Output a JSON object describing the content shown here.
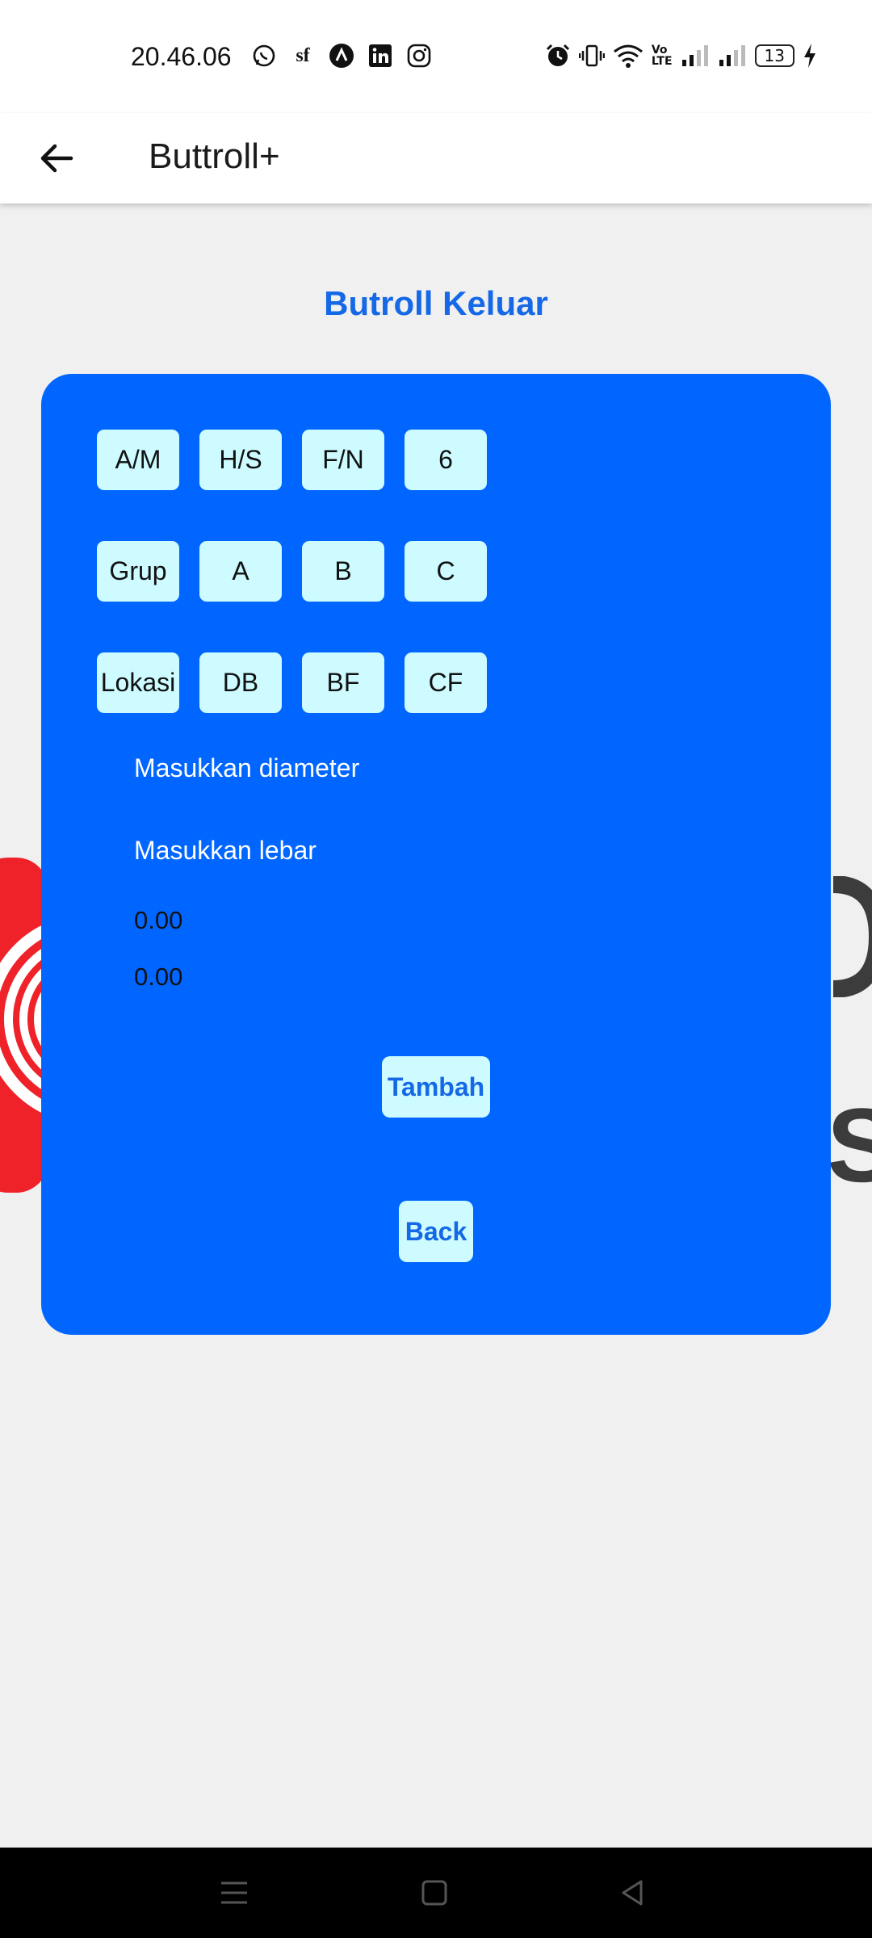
{
  "status_bar": {
    "time": "20.46.06",
    "left_icons": [
      "whatsapp-icon",
      "sf-app-icon",
      "vpn-a-icon",
      "linkedin-icon",
      "instagram-icon"
    ],
    "right_icons": [
      "alarm-icon",
      "vibrate-icon",
      "wifi-icon",
      "volte-icon",
      "signal-icon",
      "signal-icon"
    ],
    "battery": "13"
  },
  "app_bar": {
    "title": "Buttroll+"
  },
  "page": {
    "title": "Butroll Keluar"
  },
  "chips": {
    "row1": [
      "A/M",
      "H/S",
      "F/N",
      "6"
    ],
    "row2": [
      "Grup",
      "A",
      "B",
      "C"
    ],
    "row3": [
      "Lokasi",
      "DB",
      "BF",
      "CF"
    ]
  },
  "form": {
    "diameter_placeholder": "Masukkan diameter",
    "lebar_placeholder": "Masukkan lebar",
    "value1": "0.00",
    "value2": "0.00"
  },
  "buttons": {
    "tambah": "Tambah",
    "back": "Back"
  },
  "colors": {
    "card": "#0066ff",
    "chip": "#cdfbff",
    "title": "#1568e6",
    "background": "#f0f0f0"
  }
}
